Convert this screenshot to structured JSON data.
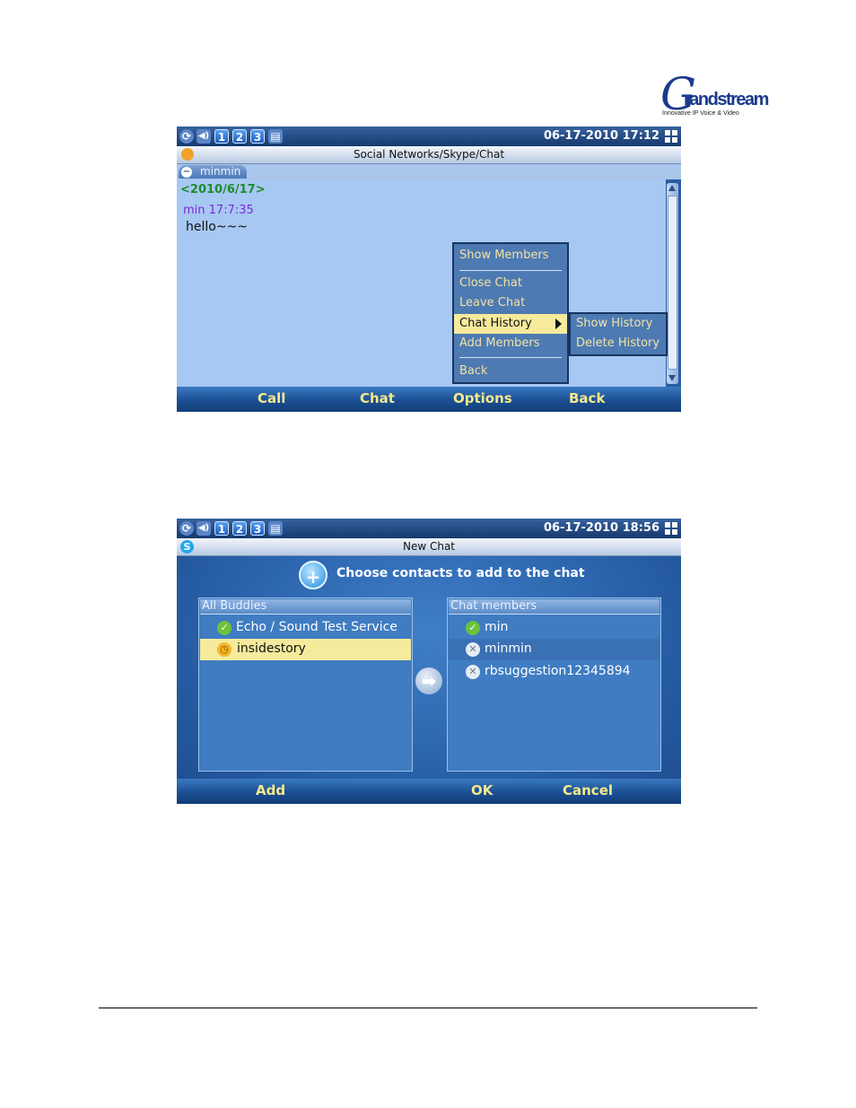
{
  "logo": {
    "letter": "G",
    "word": "randstream",
    "tagline": "Innovative IP Voice & Video"
  },
  "screen1": {
    "status": {
      "numbers": [
        "1",
        "2",
        "3"
      ],
      "datetime": "06-17-2010 17:12"
    },
    "title": "Social Networks/Skype/Chat",
    "tab": "minmin",
    "chat": {
      "date": "<2010/6/17>",
      "sender": "min  17:7:35",
      "message": "hello~~~"
    },
    "menu": {
      "items": [
        "Show Members",
        "Close Chat",
        "Leave Chat",
        "Chat History",
        "Add Members",
        "Back"
      ],
      "selected": "Chat History",
      "submenu": [
        "Show History",
        "Delete History"
      ]
    },
    "softkeys": [
      "Call",
      "Chat",
      "Options",
      "Back"
    ],
    "colors": {
      "menu_selected": "#f6ea9c",
      "chat_bg": "#a7c8f3"
    }
  },
  "screen2": {
    "status": {
      "numbers": [
        "1",
        "2",
        "3"
      ],
      "datetime": "06-17-2010 18:56"
    },
    "title": "New Chat",
    "prompt": "Choose contacts to add to the chat",
    "all_buddies": {
      "header": "All Buddies",
      "items": [
        {
          "name": "Echo / Sound Test Service",
          "status": "online"
        },
        {
          "name": "insidestory",
          "status": "away",
          "selected": true
        }
      ]
    },
    "chat_members": {
      "header": "Chat members",
      "items": [
        {
          "name": "min",
          "status": "online"
        },
        {
          "name": "minmin",
          "status": "offline"
        },
        {
          "name": "rbsuggestion12345894",
          "status": "offline"
        }
      ]
    },
    "softkeys": [
      "Add",
      "OK",
      "Cancel"
    ],
    "colors": {
      "softkey_text": "#f5e98a"
    }
  }
}
